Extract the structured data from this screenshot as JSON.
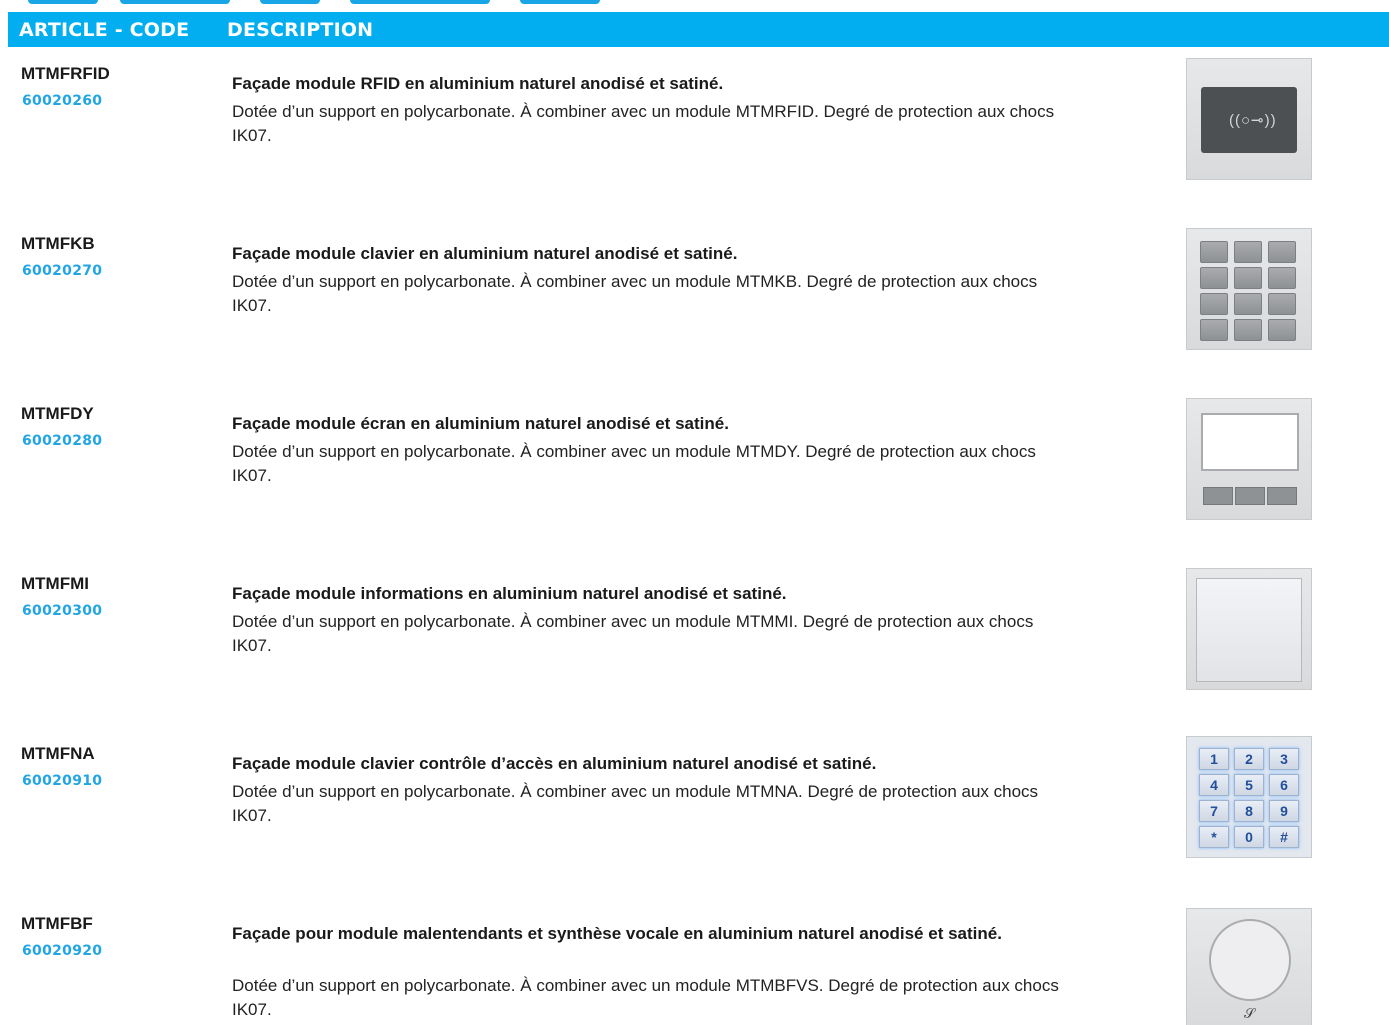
{
  "header": {
    "col_code": "ARTICLE - CODE",
    "col_desc": "DESCRIPTION"
  },
  "colors": {
    "header_bg": "#02aeef",
    "ref_text": "#21a6e3"
  },
  "items": [
    {
      "code": "MTMFRFID",
      "ref": "60020260",
      "title": "Façade module RFID en aluminium naturel anodisé et satiné.",
      "description": "Dotée d’un support en polycarbonate. À combiner avec un module MTMRFID. Degré de protection aux chocs IK07.",
      "image": "rfid-faceplate-icon"
    },
    {
      "code": "MTMFKB",
      "ref": "60020270",
      "title": "Façade module clavier en aluminium naturel anodisé et satiné.",
      "description": "Dotée d’un support en polycarbonate. À combiner avec un module MTMKB. Degré de protection aux chocs IK07.",
      "image": "keypad-faceplate-icon"
    },
    {
      "code": "MTMFDY",
      "ref": "60020280",
      "title": "Façade module écran en aluminium naturel anodisé et satiné.",
      "description": "Dotée d’un support en polycarbonate. À combiner avec un module MTMDY. Degré de protection aux chocs IK07.",
      "image": "display-faceplate-icon"
    },
    {
      "code": "MTMFMI",
      "ref": "60020300",
      "title": "Façade module informations en aluminium naturel anodisé et satiné.",
      "description": "Dotée d’un support en polycarbonate. À combiner avec un module MTMMI. Degré de protection aux chocs IK07.",
      "image": "info-faceplate-icon"
    },
    {
      "code": "MTMFNA",
      "ref": "60020910",
      "title": "Façade module clavier contrôle d’accès en aluminium naturel anodisé et satiné.",
      "description": "Dotée d’un support en polycarbonate. À combiner avec un module MTMNA. Degré de protection aux chocs IK07.",
      "image": "access-keypad-faceplate-icon",
      "keys": [
        "1",
        "2",
        "3",
        "4",
        "5",
        "6",
        "7",
        "8",
        "9",
        "*",
        "0",
        "#"
      ]
    },
    {
      "code": "MTMFBF",
      "ref": "60020920",
      "title": "Façade pour module malentendants et synthèse vocale en aluminium naturel anodisé et satiné.",
      "description": "Dotée d’un support en polycarbonate. À combiner avec un module MTMBFVS. Degré de protection aux chocs IK07.",
      "image": "hearing-loop-faceplate-icon"
    }
  ]
}
